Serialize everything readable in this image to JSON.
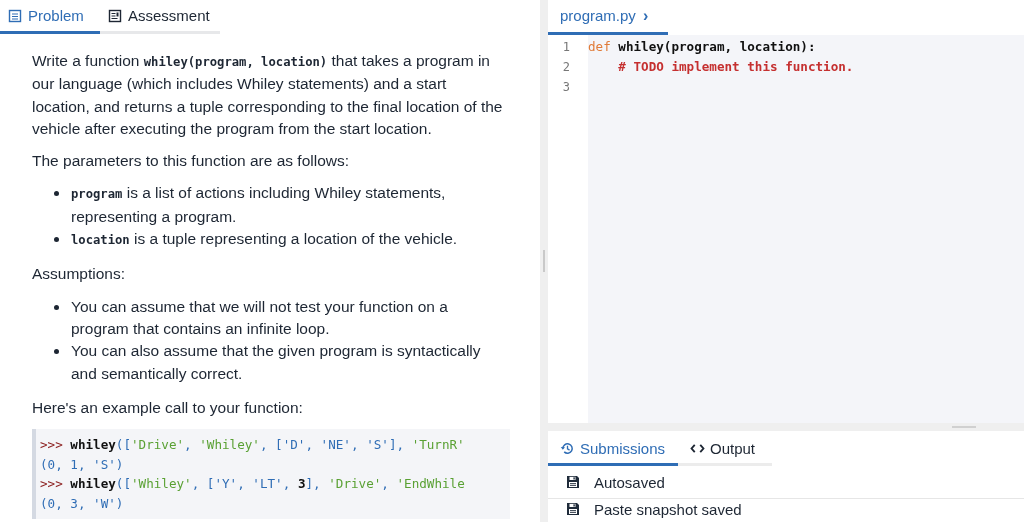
{
  "problem_tabs": [
    {
      "label": "Problem",
      "kind": "document",
      "selected": true
    },
    {
      "label": "Assessment",
      "kind": "checklist",
      "selected": false
    }
  ],
  "description": [
    {
      "kind": "paragraph",
      "parts": [
        {
          "text": "Write a function ",
          "kind": "text"
        },
        {
          "text": "whiley(program, location)",
          "kind": "code"
        },
        {
          "text": " that takes a program in our language (which includes Whiley statements) and a start location, and returns a tuple corresponding to the final location of the vehicle after executing the program from the start location.",
          "kind": "text"
        }
      ]
    },
    {
      "kind": "paragraph",
      "parts": [
        {
          "text": "The parameters to this function are as follows:",
          "kind": "text"
        }
      ]
    },
    {
      "kind": "list",
      "items": [
        [
          {
            "text": "program",
            "kind": "code"
          },
          {
            "text": " is a list of actions including Whiley statements, representing a program.",
            "kind": "text"
          }
        ],
        [
          {
            "text": "location",
            "kind": "code"
          },
          {
            "text": " is a tuple representing a location of the vehicle.",
            "kind": "text"
          }
        ]
      ]
    },
    {
      "kind": "paragraph",
      "parts": [
        {
          "text": "Assumptions:",
          "kind": "text"
        }
      ]
    },
    {
      "kind": "list",
      "items": [
        [
          {
            "text": "You can assume that we will not test your function on a program that contains an infinite loop.",
            "kind": "text"
          }
        ],
        [
          {
            "text": "You can also assume that the given program is syntactically and semantically correct.",
            "kind": "text"
          }
        ]
      ]
    },
    {
      "kind": "paragraph",
      "parts": [
        {
          "text": "Here's an example call to your function:",
          "kind": "text"
        }
      ]
    }
  ],
  "example_code": [
    [
      {
        "text": ">>> ",
        "kind": "prompt"
      },
      {
        "text": "whiley",
        "kind": "name"
      },
      {
        "text": "([",
        "kind": "punct"
      },
      {
        "text": "'Drive'",
        "kind": "string"
      },
      {
        "text": ", ",
        "kind": "punct"
      },
      {
        "text": "'Whiley'",
        "kind": "string"
      },
      {
        "text": ", [",
        "kind": "punct"
      },
      {
        "text": "'D'",
        "kind": "output"
      },
      {
        "text": ", ",
        "kind": "punct"
      },
      {
        "text": "'NE'",
        "kind": "output"
      },
      {
        "text": ", ",
        "kind": "punct"
      },
      {
        "text": "'S'",
        "kind": "output"
      },
      {
        "text": "], ",
        "kind": "punct"
      },
      {
        "text": "'TurnR'",
        "kind": "string"
      }
    ],
    [
      {
        "text": "(0, 1, 'S')",
        "kind": "output"
      }
    ],
    [
      {
        "text": ">>> ",
        "kind": "prompt"
      },
      {
        "text": "whiley",
        "kind": "name"
      },
      {
        "text": "([",
        "kind": "punct"
      },
      {
        "text": "'Whiley'",
        "kind": "string"
      },
      {
        "text": ", [",
        "kind": "punct"
      },
      {
        "text": "'Y'",
        "kind": "output"
      },
      {
        "text": ", ",
        "kind": "punct"
      },
      {
        "text": "'LT'",
        "kind": "output"
      },
      {
        "text": ", ",
        "kind": "punct"
      },
      {
        "text": "3",
        "kind": "name"
      },
      {
        "text": "], ",
        "kind": "punct"
      },
      {
        "text": "'Drive'",
        "kind": "string"
      },
      {
        "text": ", ",
        "kind": "punct"
      },
      {
        "text": "'EndWhile",
        "kind": "string"
      }
    ],
    [
      {
        "text": "(0, 3, 'W')",
        "kind": "output"
      }
    ]
  ],
  "editor": {
    "file_tab": {
      "label": "program.py",
      "chevron": "›",
      "selected": true
    },
    "lines": [
      {
        "number": "1",
        "tokens": [
          {
            "text": "def",
            "kind": "keyword"
          },
          {
            "text": " whiley(program, location):",
            "kind": "plain"
          }
        ]
      },
      {
        "number": "2",
        "tokens": [
          {
            "text": "    # TODO implement this function.",
            "kind": "comment"
          }
        ]
      },
      {
        "number": "3"
      }
    ]
  },
  "bottom_tabs": [
    {
      "label": "Submissions",
      "kind": "history",
      "selected": true
    },
    {
      "label": "Output",
      "kind": "code",
      "selected": false
    }
  ],
  "submissions": [
    {
      "label": "Autosaved"
    },
    {
      "label": "Paste snapshot saved"
    }
  ]
}
